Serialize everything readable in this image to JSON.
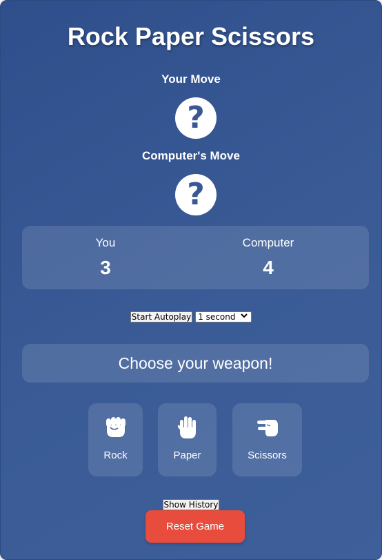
{
  "app": {
    "title": "Rock Paper Scissors"
  },
  "moves": {
    "player_label": "Your Move",
    "player_icon": "question-icon",
    "player_symbol": "?",
    "computer_label": "Computer's Move",
    "computer_icon": "question-icon",
    "computer_symbol": "?"
  },
  "score": {
    "player_label": "You",
    "player_value": "3",
    "computer_label": "Computer",
    "computer_value": "4"
  },
  "autoplay": {
    "button_label": "Start Autoplay",
    "interval_selected": "1 second"
  },
  "prompt": {
    "text": "Choose your weapon!"
  },
  "choices": [
    {
      "label": "Rock",
      "icon": "fist-icon"
    },
    {
      "label": "Paper",
      "icon": "open-hand-icon"
    },
    {
      "label": "Scissors",
      "icon": "scissors-hand-icon"
    }
  ],
  "history": {
    "button_label": "Show History"
  },
  "reset": {
    "button_label": "Reset Game",
    "color": "#e74c3c"
  },
  "theme": {
    "background_start": "#2f4f8c",
    "background_end": "#3e5f99",
    "icon_color": "#3a5894"
  }
}
